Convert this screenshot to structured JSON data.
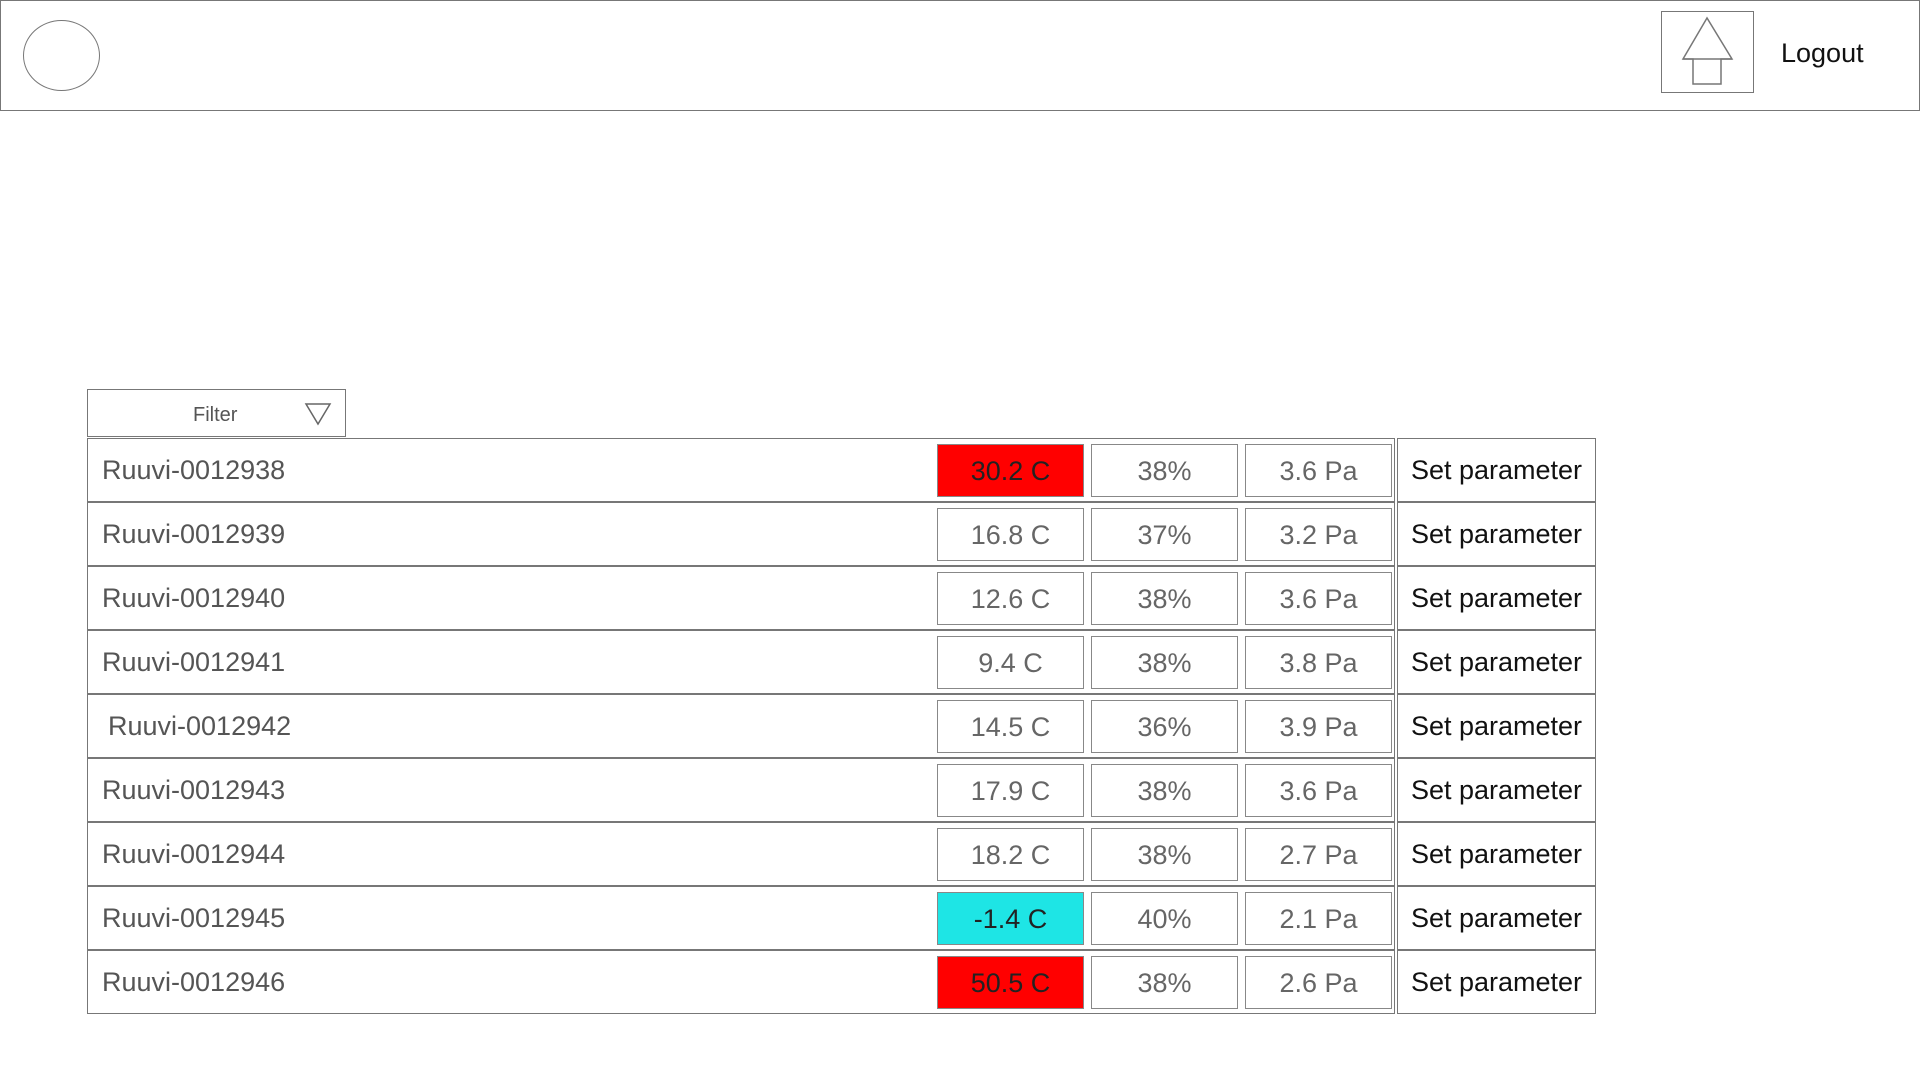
{
  "header": {
    "logout_label": "Logout"
  },
  "filter": {
    "label": "Filter"
  },
  "colors": {
    "hot": "#ff0000",
    "cold": "#1ee5e5",
    "normal": "#ffffff"
  },
  "devices": [
    {
      "name": "Ruuvi-0012938",
      "temperature": "30.2 C",
      "humidity": "38%",
      "pressure": "3.6 Pa",
      "status": "hot",
      "action": "Set parameter"
    },
    {
      "name": "Ruuvi-0012939",
      "temperature": "16.8 C",
      "humidity": "37%",
      "pressure": "3.2 Pa",
      "status": "normal",
      "action": "Set parameter"
    },
    {
      "name": "Ruuvi-0012940",
      "temperature": "12.6 C",
      "humidity": "38%",
      "pressure": "3.6 Pa",
      "status": "normal",
      "action": "Set parameter"
    },
    {
      "name": "Ruuvi-0012941",
      "temperature": "9.4 C",
      "humidity": "38%",
      "pressure": "3.8 Pa",
      "status": "normal",
      "action": "Set parameter"
    },
    {
      "name": "Ruuvi-0012942",
      "temperature": "14.5 C",
      "humidity": "36%",
      "pressure": "3.9 Pa",
      "status": "normal",
      "action": "Set parameter"
    },
    {
      "name": "Ruuvi-0012943",
      "temperature": "17.9 C",
      "humidity": "38%",
      "pressure": "3.6 Pa",
      "status": "normal",
      "action": "Set parameter"
    },
    {
      "name": "Ruuvi-0012944",
      "temperature": "18.2 C",
      "humidity": "38%",
      "pressure": "2.7 Pa",
      "status": "normal",
      "action": "Set parameter"
    },
    {
      "name": "Ruuvi-0012945",
      "temperature": "-1.4 C",
      "humidity": "40%",
      "pressure": "2.1 Pa",
      "status": "cold",
      "action": "Set parameter"
    },
    {
      "name": "Ruuvi-0012946",
      "temperature": "50.5 C",
      "humidity": "38%",
      "pressure": "2.6 Pa",
      "status": "hot",
      "action": "Set parameter"
    }
  ]
}
